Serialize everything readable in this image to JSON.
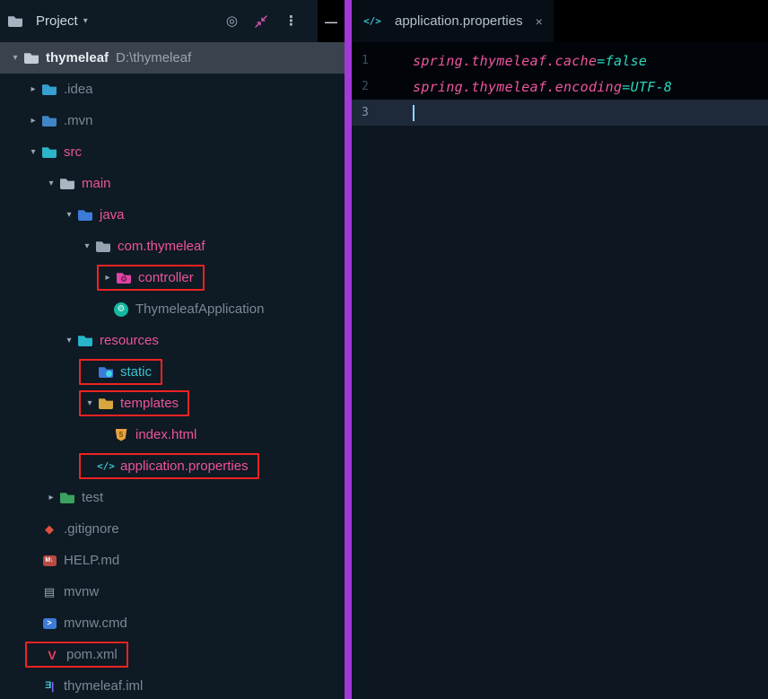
{
  "panel": {
    "title": "Project",
    "header_icons": [
      "locate-file",
      "collapse-all",
      "more-options",
      "hide-panel"
    ]
  },
  "tree": [
    {
      "label": "thymeleaf",
      "suffix": "D:\\thymeleaf",
      "indent": 0,
      "chevron": "down",
      "icon": "root-folder",
      "color": "root",
      "selected": true
    },
    {
      "label": ".idea",
      "indent": 1,
      "chevron": "right",
      "icon": "idea-folder",
      "color": "dim"
    },
    {
      "label": ".mvn",
      "indent": 1,
      "chevron": "right",
      "icon": "mvn-folder",
      "color": "dim"
    },
    {
      "label": "src",
      "indent": 1,
      "chevron": "down",
      "icon": "src-folder",
      "color": "pink"
    },
    {
      "label": "main",
      "indent": 2,
      "chevron": "down",
      "icon": "outline-folder",
      "color": "pink"
    },
    {
      "label": "java",
      "indent": 3,
      "chevron": "down",
      "icon": "java-folder",
      "color": "pink"
    },
    {
      "label": "com.thymeleaf",
      "indent": 4,
      "chevron": "down",
      "icon": "package-folder",
      "color": "pink"
    },
    {
      "label": "controller",
      "indent": 5,
      "chevron": "right",
      "icon": "controller-folder",
      "color": "pink",
      "boxed": true
    },
    {
      "label": "ThymeleafApplication",
      "indent": 5,
      "chevron": "none",
      "icon": "spring-class",
      "color": "dim"
    },
    {
      "label": "resources",
      "indent": 3,
      "chevron": "down",
      "icon": "resources-folder",
      "color": "pink"
    },
    {
      "label": "static",
      "indent": 4,
      "chevron": "none",
      "icon": "static-folder",
      "color": "teal",
      "boxed": true
    },
    {
      "label": "templates",
      "indent": 4,
      "chevron": "down",
      "icon": "templates-folder",
      "color": "pink",
      "boxed": true
    },
    {
      "label": "index.html",
      "indent": 5,
      "chevron": "none",
      "icon": "html-file",
      "color": "pink"
    },
    {
      "label": "application.properties",
      "indent": 4,
      "chevron": "none",
      "icon": "properties-file",
      "color": "pink",
      "boxed": true
    },
    {
      "label": "test",
      "indent": 2,
      "chevron": "right",
      "icon": "test-folder",
      "color": "dim"
    },
    {
      "label": ".gitignore",
      "indent": 1,
      "chevron": "none",
      "icon": "git-file",
      "color": "dim"
    },
    {
      "label": "HELP.md",
      "indent": 1,
      "chevron": "none",
      "icon": "md-file",
      "color": "dim"
    },
    {
      "label": "mvnw",
      "indent": 1,
      "chevron": "none",
      "icon": "mvnw-file",
      "color": "dim"
    },
    {
      "label": "mvnw.cmd",
      "indent": 1,
      "chevron": "none",
      "icon": "cmd-file",
      "color": "dim"
    },
    {
      "label": "pom.xml",
      "indent": 1,
      "chevron": "none",
      "icon": "maven-file",
      "color": "dim",
      "boxed": true
    },
    {
      "label": "thymeleaf.iml",
      "indent": 1,
      "chevron": "none",
      "icon": "iml-file",
      "color": "dim"
    }
  ],
  "editor": {
    "tab": {
      "label": "application.properties",
      "icon": "properties-file",
      "close_glyph": "×"
    },
    "lines": [
      {
        "number": "1",
        "key": "spring.thymeleaf.cache",
        "separator": "=",
        "value": "false"
      },
      {
        "number": "2",
        "key": "spring.thymeleaf.encoding",
        "separator": "=",
        "value": "UTF-8"
      },
      {
        "number": "3",
        "key": "",
        "separator": "",
        "value": "",
        "current": true
      }
    ]
  },
  "colors": {
    "annotation_red": "#ee2322",
    "divider_purple": "#a238d8",
    "directory_pink": "#ed539b",
    "file_dim": "#7b8897",
    "static_teal": "#3cc3ce",
    "code_key_pink": "#f0569e",
    "code_value_teal": "#2bd8bd",
    "selection_gray": "#3a424d"
  }
}
